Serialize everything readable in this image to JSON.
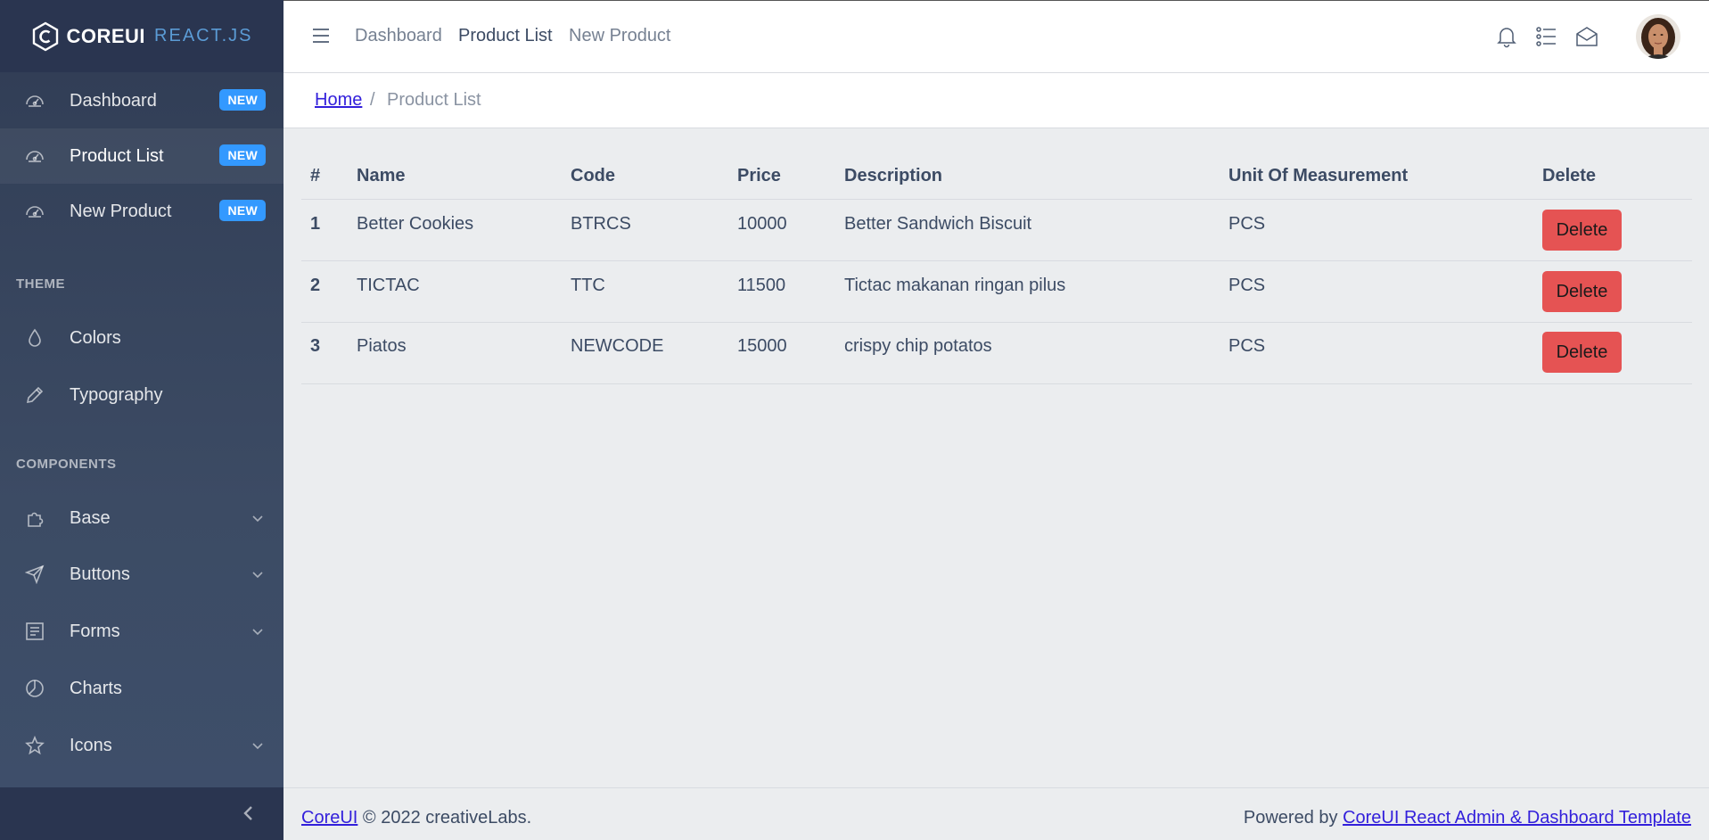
{
  "brand": {
    "name_bold": "COREUI",
    "name_light": "REACT.JS"
  },
  "sidebar": {
    "items": [
      {
        "label": "Dashboard",
        "badge": "NEW",
        "icon": "speedometer-icon"
      },
      {
        "label": "Product List",
        "badge": "NEW",
        "icon": "speedometer-icon",
        "active": true
      },
      {
        "label": "New Product",
        "badge": "NEW",
        "icon": "speedometer-icon"
      }
    ],
    "section_theme": "THEME",
    "theme_items": [
      {
        "label": "Colors",
        "icon": "drop-icon"
      },
      {
        "label": "Typography",
        "icon": "pencil-icon"
      }
    ],
    "section_components": "COMPONENTS",
    "component_items": [
      {
        "label": "Base",
        "icon": "puzzle-icon"
      },
      {
        "label": "Buttons",
        "icon": "cursor-icon"
      },
      {
        "label": "Forms",
        "icon": "notes-icon"
      },
      {
        "label": "Charts",
        "icon": "chart-pie-icon"
      },
      {
        "label": "Icons",
        "icon": "star-icon"
      }
    ]
  },
  "header": {
    "nav": [
      "Dashboard",
      "Product List",
      "New Product"
    ],
    "icons": [
      "bell-icon",
      "list-icon",
      "envelope-open-icon"
    ]
  },
  "breadcrumb": {
    "home": "Home",
    "separator": "/",
    "current": "Product List"
  },
  "table": {
    "headers": [
      "#",
      "Name",
      "Code",
      "Price",
      "Description",
      "Unit Of Measurement",
      "Delete"
    ],
    "rows": [
      {
        "no": "1",
        "name": "Better Cookies",
        "code": "BTRCS",
        "price": "10000",
        "description": "Better Sandwich Biscuit",
        "uom": "PCS",
        "action": "Delete"
      },
      {
        "no": "2",
        "name": "TICTAC",
        "code": "TTC",
        "price": "11500",
        "description": "Tictac makanan ringan pilus",
        "uom": "PCS",
        "action": "Delete"
      },
      {
        "no": "3",
        "name": "Piatos",
        "code": "NEWCODE",
        "price": "15000",
        "description": "crispy chip potatos",
        "uom": "PCS",
        "action": "Delete"
      }
    ]
  },
  "footer": {
    "left_link": "CoreUI",
    "left_text": "© 2022 creativeLabs.",
    "right_text": "Powered by",
    "right_link": "CoreUI React Admin & Dashboard Template"
  },
  "colors": {
    "sidebar": "#3c4b64",
    "badge": "#3399ff",
    "danger": "#e55353",
    "link": "#321fdb"
  }
}
